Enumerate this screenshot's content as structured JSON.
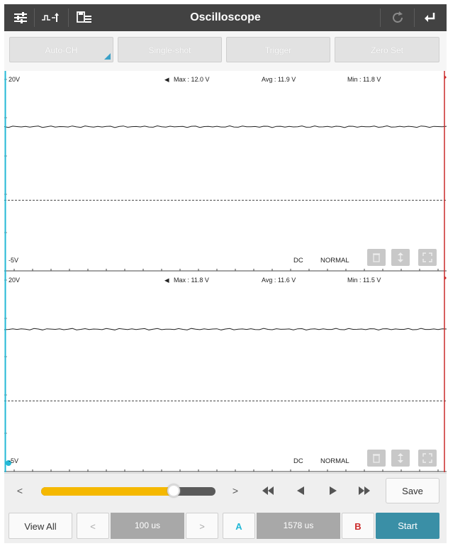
{
  "window": {
    "title": "Oscilloscope"
  },
  "toolbar": {
    "buttons": [
      {
        "label": "Auto-CH"
      },
      {
        "label": "Single-shot"
      },
      {
        "label": "Trigger"
      },
      {
        "label": "Zero Set"
      }
    ]
  },
  "channels": [
    {
      "scale_top": "20V",
      "scale_bottom": "-5V",
      "max": "Max : 12.0 V",
      "avg": "Avg : 11.9 V",
      "min": "Min : 11.8 V",
      "coupling": "DC",
      "mode": "NORMAL",
      "value": 11.9
    },
    {
      "scale_top": "20V",
      "scale_bottom": "-5V",
      "max": "Max : 11.8 V",
      "avg": "Avg : 11.6 V",
      "min": "Min : 11.5 V",
      "coupling": "DC",
      "mode": "NORMAL",
      "value": 11.6
    }
  ],
  "controls": {
    "prev": "<",
    "next": ">",
    "save_label": "Save",
    "view_all_label": "View All",
    "timebase": "100 us",
    "cursor_a_label": "A",
    "cursor_delta": "1578 us",
    "cursor_b_label": "B",
    "start_label": "Start",
    "scroll_position": 0.76
  },
  "colors": {
    "title_bar": "#424242",
    "accent_teal": "#3a8fa6",
    "cursor_a": "#22b8d6",
    "cursor_b": "#cc2a2a",
    "slider_fill": "#f5b800"
  }
}
